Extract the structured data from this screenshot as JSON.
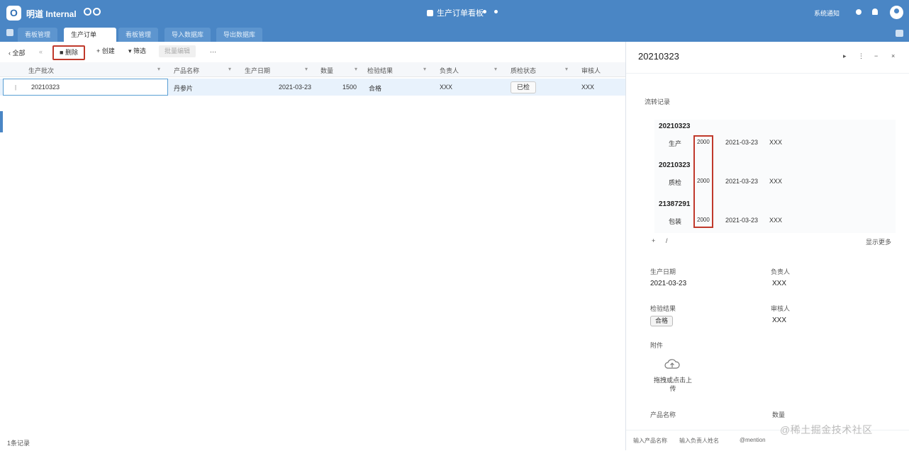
{
  "app": {
    "logo_letter": "O",
    "title": "明道 Internal"
  },
  "header": {
    "center_title": "生产订单看板",
    "right_text": "系统通知"
  },
  "tabs": [
    "看板管理",
    "生产订单",
    "看板管理",
    "导入数据库",
    "导出数据库"
  ],
  "toolbar": {
    "back": "全部",
    "b1": "删除",
    "b2": "创建",
    "b3": "筛选",
    "b4": "批量编辑",
    "more": "···"
  },
  "table": {
    "columns": [
      "生产批次",
      "产品名称",
      "生产日期",
      "数量",
      "检验结果",
      "负责人",
      "质检状态",
      "审核人"
    ],
    "rows": [
      {
        "c1": "20210323",
        "c2": "丹参片",
        "c3": "2021-03-23",
        "c4": "1500",
        "c5": "合格",
        "c6": "XXX",
        "c7": "已检",
        "c8": "XXX"
      }
    ]
  },
  "footer_left": "1条记录",
  "panel": {
    "title": "20210323",
    "controls": [
      "▸",
      "⋮",
      "−",
      "×"
    ],
    "timeline_label": "流转记录",
    "timeline": [
      {
        "head": "20210323",
        "step": "生产",
        "qty": "2000",
        "date": "2021-03-23",
        "user": "XXX"
      },
      {
        "head": "20210323",
        "step": "质检",
        "qty": "2000",
        "date": "2021-03-23",
        "user": "XXX"
      },
      {
        "head": "21387291",
        "step": "包装",
        "qty": "2000",
        "date": "2021-03-23",
        "user": "XXX"
      }
    ],
    "add_label": "+",
    "edit_label": "/",
    "show_more": "显示更多",
    "fields": {
      "date_label": "生产日期",
      "date_value": "2021-03-23",
      "owner_label": "负责人",
      "owner_value": "XXX",
      "result_label": "检验结果",
      "result_value": "合格",
      "reviewer_label": "审核人",
      "reviewer_value": "XXX",
      "attach_label": "附件",
      "upload_text": "拖拽或点击上传",
      "product_label": "产品名称",
      "count_label": "数量"
    },
    "footer": [
      "输入产品名称",
      "输入负责人姓名",
      "@mention"
    ]
  },
  "watermark": "@稀土掘金技术社区",
  "colors": {
    "accent": "#4a86c5",
    "highlight": "#c0392b"
  }
}
